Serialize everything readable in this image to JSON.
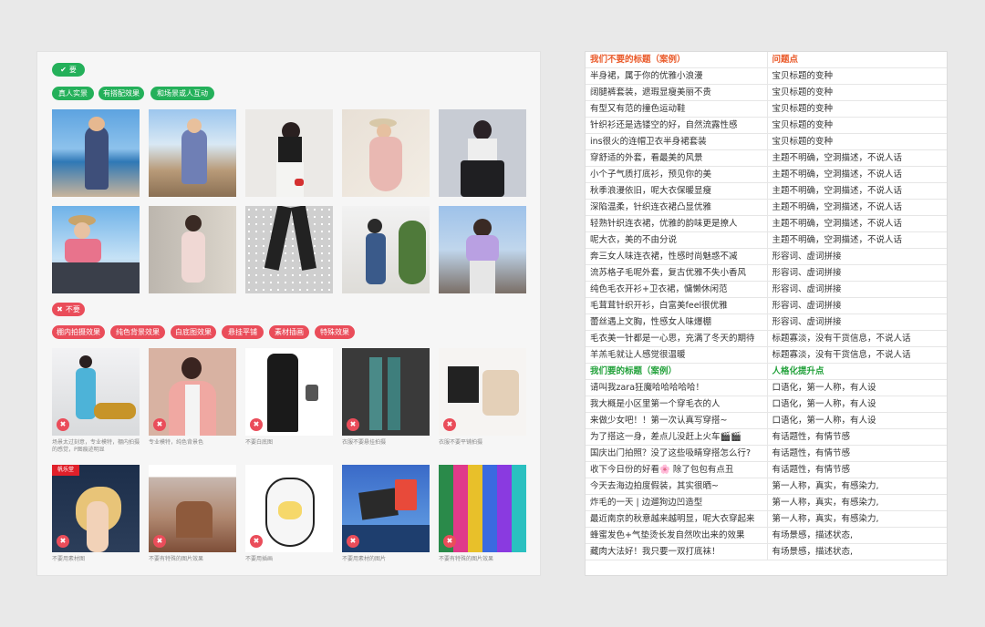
{
  "left": {
    "good_badge": "要",
    "good_tags": [
      "真人实景",
      "有搭配效果",
      "和场景或人互动"
    ],
    "bad_badge": "不要",
    "bad_tags": [
      "棚内拍摄效果",
      "纯色背景效果",
      "白底图效果",
      "悬挂平铺",
      "素材插画",
      "特殊效果"
    ],
    "bad_captions_row1": [
      "场景太过刻意，专业模特，棚内拍摄的感觉，P图痕迹明显",
      "专业模特，纯色背景色",
      "不要白底图",
      "衣服不要悬挂拍摄",
      "衣服不要平铺拍摄"
    ],
    "bad_captions_row2": [
      "不要用素材图",
      "不要有特殊的图片效果",
      "不要用插画",
      "不要用素材的图片",
      "不要有特殊的图片效果"
    ],
    "ad_label": "帆乐堂"
  },
  "table": {
    "header_bad": [
      "我们不要的标题（案例）",
      "问题点"
    ],
    "rows_bad": [
      [
        "半身裙，属于你的优雅小浪漫",
        "宝贝标题的变种"
      ],
      [
        "阔腿裤套装，遮瑕显瘦美丽不贵",
        "宝贝标题的变种"
      ],
      [
        "有型又有范的撞色运动鞋",
        "宝贝标题的变种"
      ],
      [
        "针织衫还是选镂空的好，自然流露性感",
        "宝贝标题的变种"
      ],
      [
        "ins很火的连帽卫衣半身裙套装",
        "宝贝标题的变种"
      ],
      [
        "穿舒适的外套，看最美的风景",
        "主题不明确，空洞描述，不说人话"
      ],
      [
        "小个子气质打底衫，预见你的美",
        "主题不明确，空洞描述，不说人话"
      ],
      [
        "秋季浪漫依旧，呢大衣保暖显瘦",
        "主题不明确，空洞描述，不说人话"
      ],
      [
        "深陷温柔，针织连衣裙凸显优雅",
        "主题不明确，空洞描述，不说人话"
      ],
      [
        "轻熟针织连衣裙，优雅的韵味更是撩人",
        "主题不明确，空洞描述，不说人话"
      ],
      [
        "呢大衣，美的不由分说",
        "主题不明确，空洞描述，不说人话"
      ],
      [
        "奔三女人味连衣裙，性感时尚魅惑不减",
        "形容词、虚词拼接"
      ],
      [
        "流苏格子毛呢外套，复古优雅不失小香风",
        "形容词、虚词拼接"
      ],
      [
        "纯色毛衣开衫+卫衣裙，慵懒休闲范",
        "形容词、虚词拼接"
      ],
      [
        "毛茸茸针织开衫，白富美feel很优雅",
        "形容词、虚词拼接"
      ],
      [
        "蕾丝遇上文胸，性感女人味爆棚",
        "形容词、虚词拼接"
      ],
      [
        "毛衣美一针都是一心思，充满了冬天的期待",
        "标题寡淡，没有干货信息，不说人话"
      ],
      [
        "羊羔毛就让人感觉很温暖",
        "标题寡淡，没有干货信息，不说人话"
      ]
    ],
    "header_good": [
      "我们要的标题（案例）",
      "人格化提升点"
    ],
    "rows_good": [
      [
        "请叫我zara狂魔哈哈哈哈哈！",
        "口语化，第一人称，有人设"
      ],
      [
        "我大概是小区里第一个穿毛衣的人",
        "口语化，第一人称，有人设"
      ],
      [
        "来做少女吧！！第一次认真写穿搭~",
        "口语化，第一人称，有人设"
      ],
      [
        "为了搭这一身，差点儿没赶上火车🎬🎬",
        "有话题性，有情节感"
      ],
      [
        "国庆出门拍照？没了这些吸睛穿搭怎么行?",
        "有话题性，有情节感"
      ],
      [
        "收下今日份的好看🌸 除了包包有点丑",
        "有话题性，有情节感"
      ],
      [
        "今天去海边拍度假装，其实很晒~",
        "第一人称，真实，有感染力,"
      ],
      [
        "炸毛的一天 | 边遛狗边凹造型",
        "第一人称，真实，有感染力,"
      ],
      [
        "最近南京的秋意越来越明显，呢大衣穿起来",
        "第一人称，真实，有感染力,"
      ],
      [
        "蜂蜜发色+气垫烫长发自然吹出来的效果",
        "有场景感，描述状态,"
      ],
      [
        "藏肉大法好！我只要一双打底袜！",
        "有场景感，描述状态,"
      ]
    ]
  },
  "colors": {
    "green": "#24b05a",
    "red": "#ea4d5a",
    "header_red": "#ea5a2a",
    "header_green": "#24a23c"
  }
}
